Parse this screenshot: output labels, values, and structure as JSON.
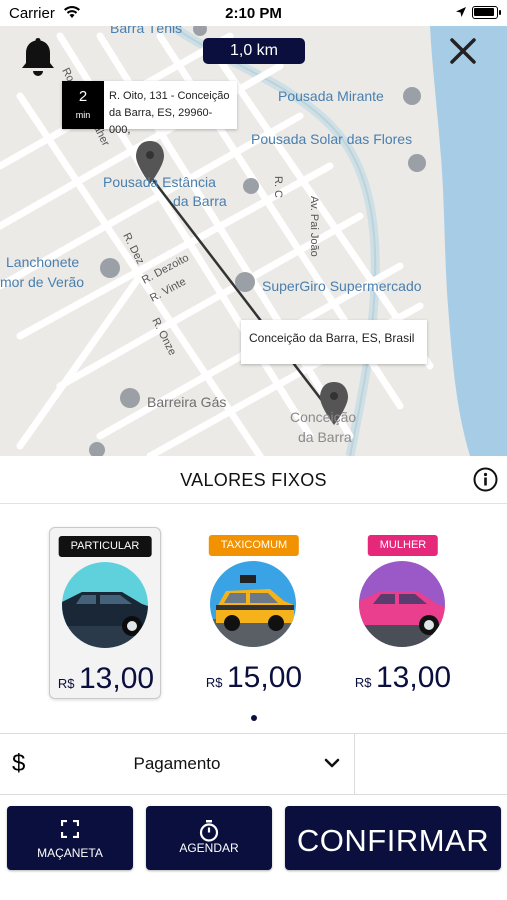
{
  "status_bar": {
    "carrier": "Carrier",
    "time": "2:10 PM"
  },
  "map": {
    "distance": "1,0 km",
    "origin": {
      "eta_value": "2",
      "eta_unit": "min",
      "address": "R. Oito, 131 - Conceição da Barra, ES, 29960-000,"
    },
    "destination": {
      "address": "Conceição da Barra, ES, Brasil"
    },
    "places": [
      "Barra Tênis",
      "Pousada Mirante",
      "Pousada Solar das Flores",
      "Pousada Estância",
      "da Barra",
      "Lanchonete",
      "mor de Verão",
      "SuperGiro Supermercado",
      "Barreira Gás",
      "Conceição",
      "da Barra"
    ],
    "streets": [
      "Rod. Pe...",
      "Daher",
      "R. C",
      "Av. Pai João",
      "R. Dez",
      "R. Dezoito",
      "R. Vinte",
      "R. Onze"
    ]
  },
  "fixed_values": {
    "title": "VALORES FIXOS"
  },
  "ride_options": [
    {
      "badge": "PARTICULAR",
      "badge_color": "#111111",
      "currency": "R$",
      "price": "13,00",
      "selected": true
    },
    {
      "badge": "TAXICOMUM",
      "badge_color": "#f39200",
      "currency": "R$",
      "price": "15,00",
      "selected": false
    },
    {
      "badge": "MULHER",
      "badge_color": "#e6287a",
      "currency": "R$",
      "price": "13,00",
      "selected": false
    }
  ],
  "payment": {
    "icon_symbol": "$",
    "label": "Pagamento"
  },
  "actions": {
    "handle_label": "MAÇANETA",
    "schedule_label": "AGENDAR",
    "confirm_label": "CONFIRMAR"
  },
  "icons": [
    "wifi-icon",
    "location-arrow-icon",
    "battery-icon",
    "bell-icon",
    "close-icon",
    "info-icon",
    "chevron-down-icon",
    "expand-icon",
    "stopwatch-icon"
  ],
  "colors": {
    "primary_navy": "#0b0f3d",
    "map_water": "#a7cde6",
    "map_label_blue": "#4a7fae"
  }
}
